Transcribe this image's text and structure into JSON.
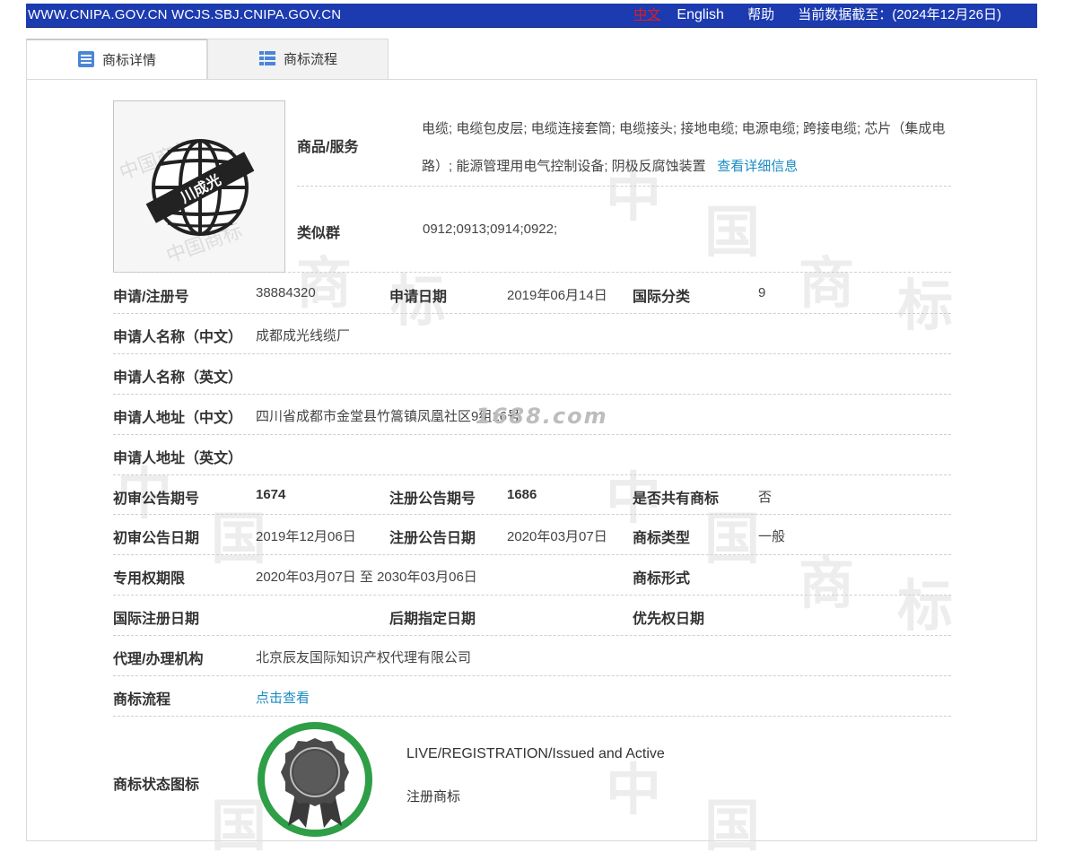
{
  "topbar": {
    "sites": "WWW.CNIPA.GOV.CN WCJS.SBJ.CNIPA.GOV.CN",
    "lang_zh": "中文",
    "lang_en": "English",
    "help": "帮助",
    "data_date": "当前数据截至：(2024年12月26日)",
    "bar_color": "#1c3bb0"
  },
  "tabs": [
    {
      "label": "商标详情",
      "icon": "document-list-icon",
      "active": true
    },
    {
      "label": "商标流程",
      "icon": "table-grid-icon",
      "active": false
    }
  ],
  "logo": {
    "text": "川成光",
    "icon": "globe-trademark-image"
  },
  "watermark": {
    "text": "1688.com"
  },
  "goods": {
    "label": "商品/服务",
    "value": "电缆; 电缆包皮层; 电缆连接套筒; 电缆接头; 接地电缆; 电源电缆; 跨接电缆; 芯片（集成电路）; 能源管理用电气控制设备; 阴极反腐蚀装置",
    "detail_link": "查看详细信息"
  },
  "similar_group": {
    "label": "类似群",
    "value": "0912;0913;0914;0922;"
  },
  "fields": {
    "reg_no_label": "申请/注册号",
    "reg_no": "38884320",
    "app_date_label": "申请日期",
    "app_date": "2019年06月14日",
    "intl_class_label": "国际分类",
    "intl_class": "9",
    "applicant_cn_label": "申请人名称（中文）",
    "applicant_cn": "成都成光线缆厂",
    "applicant_en_label": "申请人名称（英文）",
    "applicant_en": "",
    "address_cn_label": "申请人地址（中文）",
    "address_cn": "四川省成都市金堂县竹篙镇凤凰社区9组16号",
    "address_en_label": "申请人地址（英文）",
    "address_en": "",
    "prelim_no_label": "初审公告期号",
    "prelim_no": "1674",
    "reg_pub_no_label": "注册公告期号",
    "reg_pub_no": "1686",
    "shared_label": "是否共有商标",
    "shared": "否",
    "prelim_date_label": "初审公告日期",
    "prelim_date": "2019年12月06日",
    "reg_pub_date_label": "注册公告日期",
    "reg_pub_date": "2020年03月07日",
    "tm_type_label": "商标类型",
    "tm_type": "一般",
    "exclusive_label": "专用权期限",
    "exclusive": "2020年03月07日 至 2030年03月06日",
    "tm_form_label": "商标形式",
    "tm_form": "",
    "intl_reg_date_label": "国际注册日期",
    "intl_reg_date": "",
    "later_designation_label": "后期指定日期",
    "later_designation": "",
    "priority_date_label": "优先权日期",
    "priority_date": "",
    "agent_label": "代理/办理机构",
    "agent": "北京辰友国际知识产权代理有限公司",
    "process_label": "商标流程",
    "process_link": "点击查看",
    "status_label": "商标状态图标",
    "status_en": "LIVE/REGISTRATION/Issued and Active",
    "status_cn": "注册商标"
  }
}
